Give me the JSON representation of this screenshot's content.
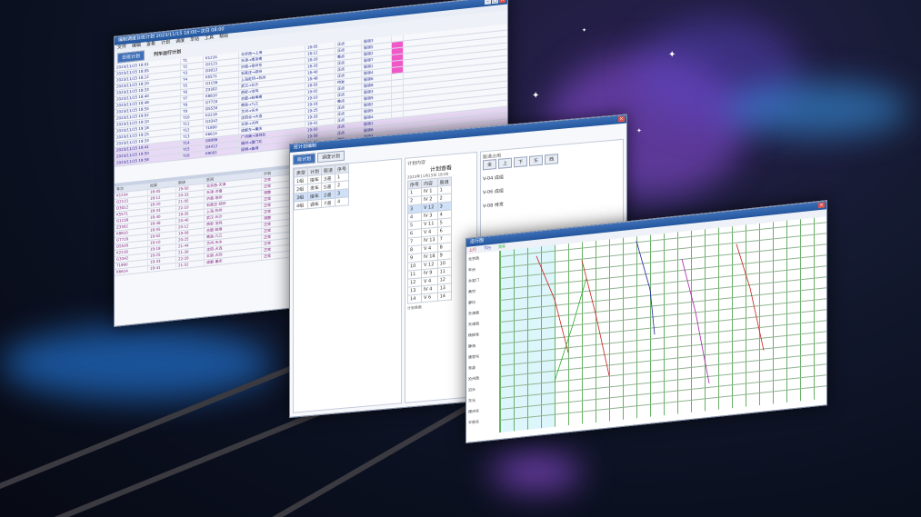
{
  "window_main": {
    "title": "编制调度日班计划 2023/11/15 18:00~次日 08:00",
    "menu": [
      "文件",
      "编辑",
      "查看",
      "计划",
      "调度",
      "车站",
      "工具",
      "帮助"
    ],
    "panel_caption": "列车运行计划",
    "toolbar_tab": "日班计划",
    "rows": [
      [
        "2023/11/15 18:01",
        "T1",
        "K1234",
        "北京西→上海",
        "18:05",
        "正点",
        "股道3"
      ],
      [
        "2023/11/15 18:05",
        "T2",
        "G2121",
        "天津→南京南",
        "18:12",
        "正点",
        "股道5"
      ],
      [
        "2023/11/15 18:12",
        "T3",
        "D3012",
        "济南→徐州东",
        "18:20",
        "晚点",
        "股道2"
      ],
      [
        "2023/11/15 18:20",
        "T4",
        "K5571",
        "石家庄→郑州",
        "18:33",
        "正点",
        "股道7"
      ],
      [
        "2023/11/15 18:33",
        "T5",
        "G1156",
        "上海虹桥→杭州",
        "18:40",
        "正点",
        "股道1"
      ],
      [
        "2023/11/15 18:40",
        "T6",
        "Z3302",
        "武汉→长沙",
        "18:48",
        "正点",
        "股道4"
      ],
      [
        "2023/11/15 18:48",
        "T7",
        "K8810",
        "西安→宝鸡",
        "18:55",
        "待发",
        "股道6"
      ],
      [
        "2023/11/15 18:55",
        "T8",
        "G7720",
        "合肥→蚌埠南",
        "19:02",
        "正点",
        "股道8"
      ],
      [
        "2023/11/15 19:02",
        "T9",
        "D5530",
        "南昌→九江",
        "19:10",
        "正点",
        "股道3"
      ],
      [
        "2023/11/15 19:10",
        "T10",
        "K2218",
        "兰州→天水",
        "19:18",
        "晚点",
        "股道9"
      ],
      [
        "2023/11/15 19:18",
        "T11",
        "G3342",
        "沈阳北→大连",
        "19:25",
        "正点",
        "股道2"
      ],
      [
        "2023/11/15 19:25",
        "T12",
        "T1890",
        "太原→大同",
        "19:33",
        "正点",
        "股道5"
      ],
      [
        "2023/11/15 19:33",
        "T13",
        "K6614",
        "成都东→重庆",
        "19:41",
        "正点",
        "股道4"
      ],
      [
        "2023/11/15 19:41",
        "T14",
        "G8086",
        "广州南→深圳北",
        "19:50",
        "正点",
        "股道1"
      ],
      [
        "2023/11/15 19:50",
        "T15",
        "D4412",
        "福州→厦门北",
        "19:58",
        "正点",
        "股道6"
      ],
      [
        "2023/11/15 19:58",
        "T16",
        "K9001",
        "昆明→曲靖",
        "20:06",
        "待发",
        "股道7"
      ]
    ],
    "lower_rows": [
      [
        "车次",
        "出发",
        "到达",
        "区间",
        "计划",
        "状态"
      ],
      [
        "K1234",
        "18:05",
        "19:50",
        "北京西-天津",
        "正常",
        "—"
      ],
      [
        "G2121",
        "18:12",
        "20:33",
        "天津-济南",
        "正常",
        "—"
      ],
      [
        "D3012",
        "18:20",
        "21:05",
        "济南-徐州",
        "调整",
        "—"
      ],
      [
        "K5571",
        "18:33",
        "22:10",
        "石家庄-郑州",
        "正常",
        "—"
      ],
      [
        "G1156",
        "18:40",
        "19:35",
        "上海-杭州",
        "正常",
        "—"
      ],
      [
        "Z3302",
        "18:48",
        "20:40",
        "武汉-长沙",
        "正常",
        "—"
      ],
      [
        "K8810",
        "18:55",
        "20:12",
        "西安-宝鸡",
        "调整",
        "—"
      ],
      [
        "G7720",
        "19:02",
        "19:58",
        "合肥-蚌埠",
        "正常",
        "—"
      ],
      [
        "D5530",
        "19:10",
        "20:25",
        "南昌-九江",
        "正常",
        "—"
      ],
      [
        "K2218",
        "19:18",
        "21:44",
        "兰州-天水",
        "正常",
        "—"
      ],
      [
        "G3342",
        "19:25",
        "21:30",
        "沈阳-大连",
        "正常",
        "—"
      ],
      [
        "T1890",
        "19:33",
        "22:20",
        "太原-大同",
        "正常",
        "—"
      ],
      [
        "K6614",
        "19:41",
        "21:52",
        "成都-重庆",
        "正常",
        "—"
      ]
    ]
  },
  "window_plan": {
    "title": "班计划编制",
    "tabs": [
      "班计划",
      "调度计划"
    ],
    "left_headers": [
      "类型",
      "计划",
      "股道",
      "序号"
    ],
    "left_rows": [
      [
        "1组",
        "接车",
        "3道",
        "1"
      ],
      [
        "2组",
        "发车",
        "5道",
        "2"
      ],
      [
        "3组",
        "接车",
        "2道",
        "3"
      ],
      [
        "4组",
        "调车",
        "7道",
        "4"
      ]
    ],
    "mid_caption": "计划内容",
    "mid_title": "计划查看",
    "mid_subtitle": "2023年11月15日 18:00",
    "mid_headers": [
      "序号",
      "内容",
      "股道"
    ],
    "mid_rows": [
      [
        "1",
        "Ⅳ 1",
        "1"
      ],
      [
        "2",
        "Ⅳ 2",
        "2"
      ],
      [
        "3",
        "Ⅴ 12",
        "3"
      ],
      [
        "4",
        "Ⅳ 3",
        "4"
      ],
      [
        "5",
        "Ⅴ 11",
        "5"
      ],
      [
        "6",
        "Ⅴ 4",
        "6"
      ],
      [
        "7",
        "Ⅳ 13",
        "7"
      ],
      [
        "8",
        "Ⅴ 4",
        "8"
      ],
      [
        "9",
        "Ⅳ 18",
        "9"
      ],
      [
        "10",
        "Ⅴ 12",
        "10"
      ],
      [
        "11",
        "Ⅳ 9",
        "11"
      ],
      [
        "12",
        "Ⅴ 4",
        "12"
      ],
      [
        "13",
        "Ⅳ 4",
        "13"
      ],
      [
        "14",
        "Ⅴ 6",
        "14"
      ]
    ],
    "mid_footer": "计划条数",
    "right_caption": "股道占用",
    "right_tabs": [
      "全",
      "上",
      "下",
      "东",
      "西"
    ],
    "right_items": [
      "V-04 成组",
      "V-06 成组",
      "V-08 待发"
    ]
  },
  "window_graph": {
    "title": "运行图",
    "station_labels": [
      "北京西",
      "丰台",
      "永定门",
      "黄村",
      "廊坊",
      "天津南",
      "天津西",
      "杨柳青",
      "静海",
      "唐官屯",
      "青县",
      "沧州西",
      "泊头",
      "东光",
      "德州东",
      "平原东"
    ],
    "legend": [
      "上行",
      "下行",
      "货车"
    ]
  },
  "colors": {
    "accent": "#3e6fb8",
    "highlight": "#f257c8",
    "graph_line": "#4a9e4a"
  }
}
